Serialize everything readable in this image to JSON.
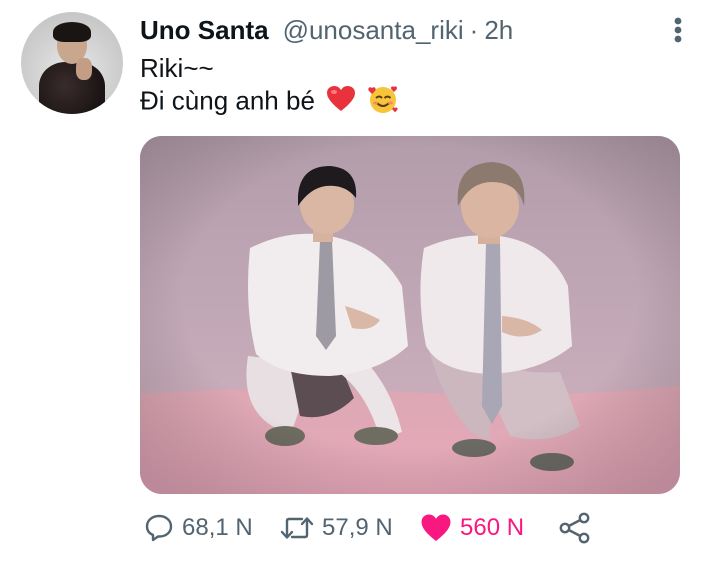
{
  "tweet": {
    "author_name": "Uno Santa",
    "author_handle": "@unosanta_riki",
    "separator": "·",
    "time": "2h",
    "text_line1": "Riki~~",
    "text_line2": "Đi cùng anh bé",
    "emojis": [
      "red-heart",
      "smiling-face-with-hearts"
    ]
  },
  "actions": {
    "reply_count": "68,1 N",
    "retweet_count": "57,9 N",
    "like_count": "560 N",
    "liked": true
  },
  "colors": {
    "text": "#0f1419",
    "secondary": "#536471",
    "like": "#f91880"
  }
}
